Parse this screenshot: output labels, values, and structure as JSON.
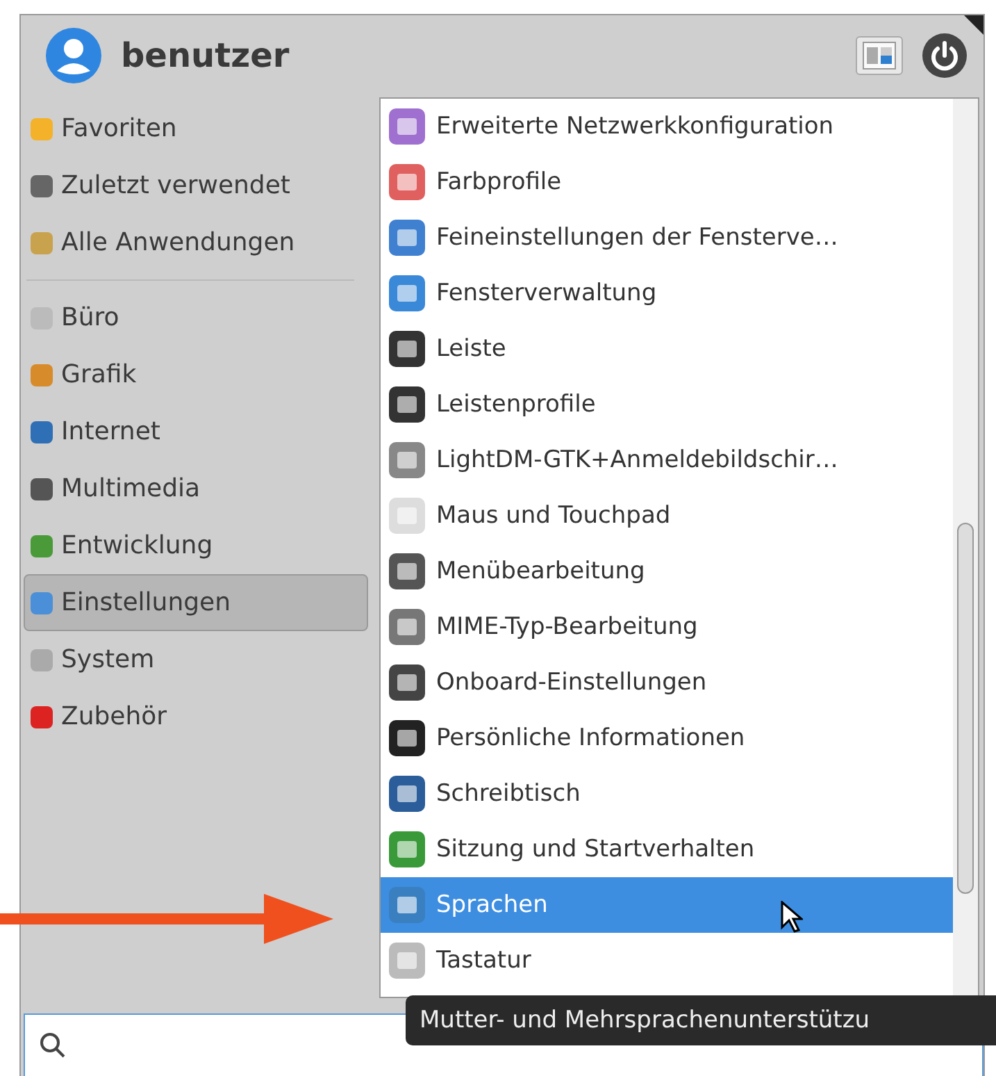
{
  "header": {
    "username": "benutzer"
  },
  "sidebar": {
    "groups": [
      [
        {
          "label": "Favoriten",
          "selected": false
        },
        {
          "label": "Zuletzt verwendet",
          "selected": false
        },
        {
          "label": "Alle Anwendungen",
          "selected": false
        }
      ],
      [
        {
          "label": "Büro",
          "selected": false
        },
        {
          "label": "Grafik",
          "selected": false
        },
        {
          "label": "Internet",
          "selected": false
        },
        {
          "label": "Multimedia",
          "selected": false
        },
        {
          "label": "Entwicklung",
          "selected": false
        },
        {
          "label": "Einstellungen",
          "selected": true
        },
        {
          "label": "System",
          "selected": false
        },
        {
          "label": "Zubehör",
          "selected": false
        }
      ]
    ]
  },
  "apps": [
    {
      "label": "Erweiterte Netzwerkkonfiguration",
      "selected": false
    },
    {
      "label": "Farbprofile",
      "selected": false
    },
    {
      "label": "Feineinstellungen der Fensterve…",
      "selected": false
    },
    {
      "label": "Fensterverwaltung",
      "selected": false
    },
    {
      "label": "Leiste",
      "selected": false
    },
    {
      "label": "Leistenprofile",
      "selected": false
    },
    {
      "label": "LightDM-GTK+Anmeldebildschir…",
      "selected": false
    },
    {
      "label": "Maus und Touchpad",
      "selected": false
    },
    {
      "label": "Menübearbeitung",
      "selected": false
    },
    {
      "label": "MIME-Typ-Bearbeitung",
      "selected": false
    },
    {
      "label": "Onboard-Einstellungen",
      "selected": false
    },
    {
      "label": "Persönliche Informationen",
      "selected": false
    },
    {
      "label": "Schreibtisch",
      "selected": false
    },
    {
      "label": "Sitzung und Startverhalten",
      "selected": false
    },
    {
      "label": "Sprachen",
      "selected": true
    },
    {
      "label": "Tastatur",
      "selected": false
    }
  ],
  "tooltip": "Mutter- und Mehrsprachenunterstützu"
}
